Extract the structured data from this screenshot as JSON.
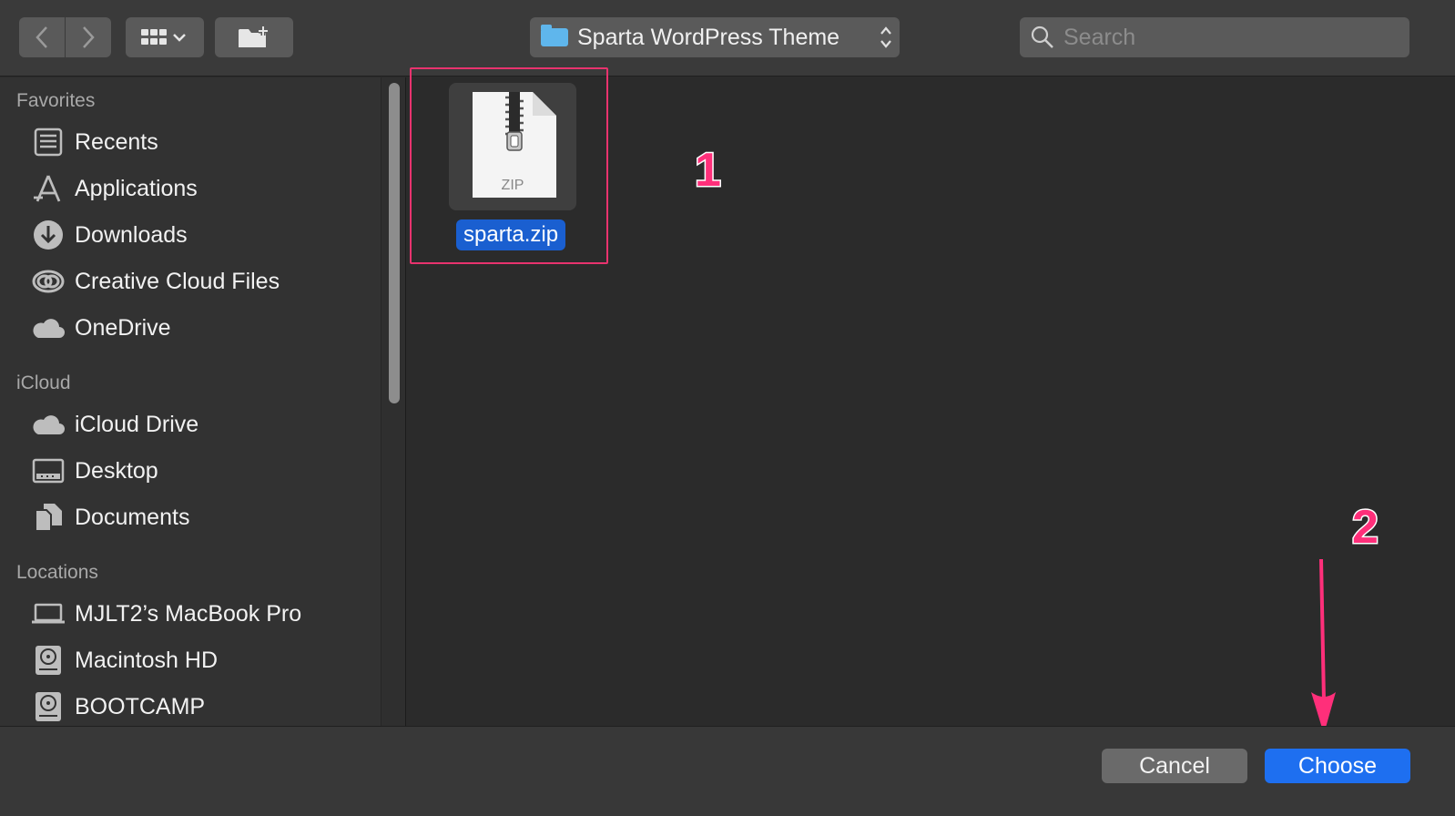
{
  "toolbar": {
    "back_icon": "chevron-left-icon",
    "forward_icon": "chevron-right-icon",
    "view_icon": "grid-view-icon",
    "new_folder_icon": "new-folder-icon",
    "location": "Sparta WordPress Theme",
    "search_placeholder": "Search"
  },
  "sidebar": {
    "sections": [
      {
        "title": "Favorites",
        "items": [
          {
            "label": "Recents",
            "icon": "recents-icon"
          },
          {
            "label": "Applications",
            "icon": "applications-icon"
          },
          {
            "label": "Downloads",
            "icon": "downloads-icon"
          },
          {
            "label": "Creative Cloud Files",
            "icon": "creative-cloud-icon"
          },
          {
            "label": "OneDrive",
            "icon": "cloud-icon"
          }
        ]
      },
      {
        "title": "iCloud",
        "items": [
          {
            "label": "iCloud Drive",
            "icon": "icloud-icon"
          },
          {
            "label": "Desktop",
            "icon": "desktop-icon"
          },
          {
            "label": "Documents",
            "icon": "documents-icon"
          }
        ]
      },
      {
        "title": "Locations",
        "items": [
          {
            "label": "MJLT2’s MacBook Pro",
            "icon": "laptop-icon"
          },
          {
            "label": "Macintosh HD",
            "icon": "hard-disk-icon"
          },
          {
            "label": "BOOTCAMP",
            "icon": "hard-disk-icon"
          }
        ]
      }
    ]
  },
  "files": [
    {
      "name": "sparta.zip",
      "type_label": "ZIP",
      "selected": true
    }
  ],
  "annotations": [
    "1",
    "2"
  ],
  "buttons": {
    "cancel": "Cancel",
    "choose": "Choose"
  },
  "colors": {
    "accent": "#1e6ff0",
    "selection": "#1a5fd0",
    "annotation": "#ff2f7a"
  }
}
